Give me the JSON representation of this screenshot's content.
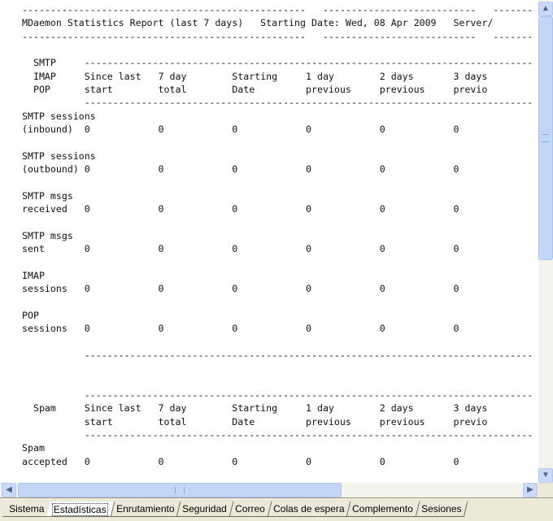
{
  "report": {
    "lines": [
      "--------------------------------------------------   ---------------------------   -------",
      "MDaemon Statistics Report (last 7 days)   Starting Date: Wed, 08 Apr 2009   Server/",
      "--------------------------------------------------   ---------------------------   -------",
      "",
      "  SMTP     -------------------------------------------------------------------------------",
      "  IMAP     Since last   7 day        Starting     1 day        2 days       3 days",
      "  POP      start        total        Date         previous     previous     previo",
      "           -------------------------------------------------------------------------------",
      "SMTP sessions",
      "(inbound)  0            0            0            0            0            0",
      "",
      "SMTP sessions",
      "(outbound) 0            0            0            0            0            0",
      "",
      "SMTP msgs",
      "received   0            0            0            0            0            0",
      "",
      "SMTP msgs",
      "sent       0            0            0            0            0            0",
      "",
      "IMAP",
      "sessions   0            0            0            0            0            0",
      "",
      "POP",
      "sessions   0            0            0            0            0            0",
      "",
      "           -------------------------------------------------------------------------------",
      "",
      "",
      "           -------------------------------------------------------------------------------",
      "  Spam     Since last   7 day        Starting     1 day        2 days       3 days",
      "           start        total        Date         previous     previous     previo",
      "           -------------------------------------------------------------------------------",
      "Spam",
      "accepted   0            0            0            0            0            0"
    ]
  },
  "scrollbars": {
    "up_glyph": "▲",
    "down_glyph": "▼",
    "left_glyph": "◀",
    "right_glyph": "▶"
  },
  "tabs": [
    {
      "label": "Sistema",
      "active": false
    },
    {
      "label": "Estadísticas",
      "active": true
    },
    {
      "label": "Enrutamiento",
      "active": false
    },
    {
      "label": "Seguridad",
      "active": false
    },
    {
      "label": "Correo",
      "active": false
    },
    {
      "label": "Colas de espera",
      "active": false
    },
    {
      "label": "Complemento",
      "active": false
    },
    {
      "label": "Sesiones",
      "active": false
    }
  ]
}
